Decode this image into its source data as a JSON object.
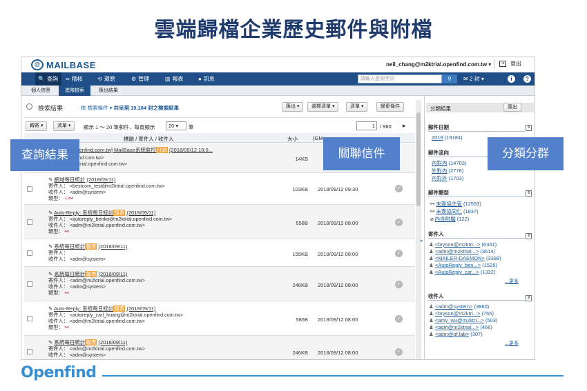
{
  "slide_title": "雲端歸檔企業歷史郵件與附檔",
  "app": {
    "logo": "MAILBASE",
    "user_email": "neil_chang@m2ktrial.openfind.com.tw ▾",
    "logout": "登出",
    "nav": [
      {
        "icon": "🔍",
        "label": "查詢"
      },
      {
        "icon": "∞",
        "label": "稽核"
      },
      {
        "icon": "⟲",
        "label": "還原"
      },
      {
        "icon": "⚙",
        "label": "管理"
      },
      {
        "icon": "▥",
        "label": "報表"
      },
      {
        "icon": "●",
        "label": "訊息"
      }
    ],
    "search_placeholder": "請輸入查詢字詞",
    "cart_count": "2 封",
    "subtabs": [
      "個人信匣",
      "進階檢索",
      "匯出結果"
    ]
  },
  "results": {
    "title": "檢索結果",
    "summary_prefix": "依",
    "summary_sort": "檢索條件 ▾",
    "summary_text": "共呈現 19,184 封之檢索結果",
    "buttons": {
      "export": "匯出 ▾",
      "select_list": "選擇清單 ▾",
      "list": "清單 ▾",
      "change_cond": "變更條件"
    },
    "toolbar": {
      "forward": "轉寄 ▾",
      "list": "清單 ▾",
      "range": "顯示 1 ～ 20 筆郵件，每頁顯示",
      "per_page": "20 ▾",
      "unit": "筆",
      "page": "1",
      "pages": "/ 960"
    },
    "head": {
      "subject": "標題 / 寄件人 / 收件人",
      "size": "大小",
      "date": "(GM"
    },
    "rows": [
      {
        "subject": "al.m2ktrial.openfind.com.tw] MailBase系統監控",
        "hl": "日誌",
        "subject_tail": "(2018/09/12 10:0...",
        "from": "mbtrial.openfind.com.tw>",
        "to": "k_chen@m2ktrial.openfind.com.tw>",
        "size": "14KB",
        "date": ""
      },
      {
        "subject": "網域每日統計",
        "hl": "",
        "subject_tail": "(2018/09/11)",
        "from": "寄件人： <bestcom_test@m2ktrial.openfind.com.tw>",
        "to": "收件人： <adm@system>",
        "type": "類型：",
        "size": "103KB",
        "date": "2018/09/12 09:30"
      },
      {
        "subject": "Auto-Reply: 系統每日統計",
        "hl": "報表",
        "subject_tail": "(2018/09/11)",
        "from": "寄件人： <autoreply_benko@m2ktrial.openfind.com.tw>",
        "to": "收件人： <adm@m2ktrial.openfind.com.tw>",
        "type": "類型：",
        "size": "558B",
        "date": "2018/09/12 08:00"
      },
      {
        "subject": "系統每日統計",
        "hl": "報表",
        "subject_tail": "(2018/09/11)",
        "from": "寄件人：",
        "to": "收件人： <adm@system>",
        "type": "",
        "size": "155KB",
        "date": "2018/09/12 08:00"
      },
      {
        "subject": "系統每日統計",
        "hl": "報表",
        "subject_tail": "(2018/09/11)",
        "from": "寄件人： <adm@m2ktrial.openfind.com.tw>",
        "to": "收件人： <adm@system>",
        "type": "類型：",
        "size": "246KB",
        "date": "2018/09/12 08:00"
      },
      {
        "subject": "Auto-Reply: 系統每日統計",
        "hl": "報表",
        "subject_tail": "(2018/09/11)",
        "from": "寄件人： <autoreply_carl_huang@m2ktrial.openfind.com.tw>",
        "to": "收件人： <adm@m2ktrial.openfind.com.tw>",
        "type": "類型：",
        "size": "586B",
        "date": "2018/09/12 08:00"
      },
      {
        "subject": "系統每日統計",
        "hl": "報表",
        "subject_tail": "(2018/09/11)",
        "from": "寄件人： <adm@m2ktrial.openfind.com.tw>",
        "to": "收件人： <adm@system>",
        "type": "",
        "size": "246KB",
        "date": "2018/09/12 08:00"
      }
    ]
  },
  "panel": {
    "title": "分類結果",
    "export": "匯出",
    "sections": [
      {
        "title": "郵件日期",
        "items": [
          {
            "label": "2018",
            "count": "(19184)"
          }
        ]
      },
      {
        "title": "郵件流向",
        "items": [
          {
            "label": "內對內",
            "count": "(14703)"
          },
          {
            "label": "外對內",
            "count": "(2778)"
          },
          {
            "label": "內對外",
            "count": "(1703)"
          }
        ]
      },
      {
        "title": "郵件類型",
        "items": [
          {
            "label": "未簽協主管",
            "count": "(12593)"
          },
          {
            "label": "未簽協同仁",
            "count": "(1837)"
          },
          {
            "label": "內含附檔",
            "count": "(122)"
          }
        ]
      },
      {
        "title": "寄件人",
        "items": [
          {
            "label": "<bryson@m2ktri...>",
            "count": "(6341)"
          },
          {
            "label": "<adm@m2ktrial...>",
            "count": "(3614)"
          },
          {
            "label": "<MAILER-DAEMON>",
            "count": "(3388)"
          },
          {
            "label": "<AutoReply_ben...>",
            "count": "(1525)"
          },
          {
            "label": "<AutoReply_car...>",
            "count": "(1332)"
          }
        ],
        "more": "...更多"
      },
      {
        "title": "收件人",
        "items": [
          {
            "label": "<adm@system>",
            "count": "(3860)"
          },
          {
            "label": "<bryson@m2ktri...>",
            "count": "(755)"
          },
          {
            "label": "<amy_wu@m2ktri...>",
            "count": "(503)"
          },
          {
            "label": "<adm@m2ktrial...>",
            "count": "(466)"
          },
          {
            "label": "<adm@of.lab>",
            "count": "(307)"
          }
        ],
        "more": "...更多"
      }
    ]
  },
  "overlays": {
    "query_result": "查詢結果",
    "related_mail": "關聯信件",
    "category": "分類分群"
  },
  "footer": {
    "brand": "Openfind"
  }
}
